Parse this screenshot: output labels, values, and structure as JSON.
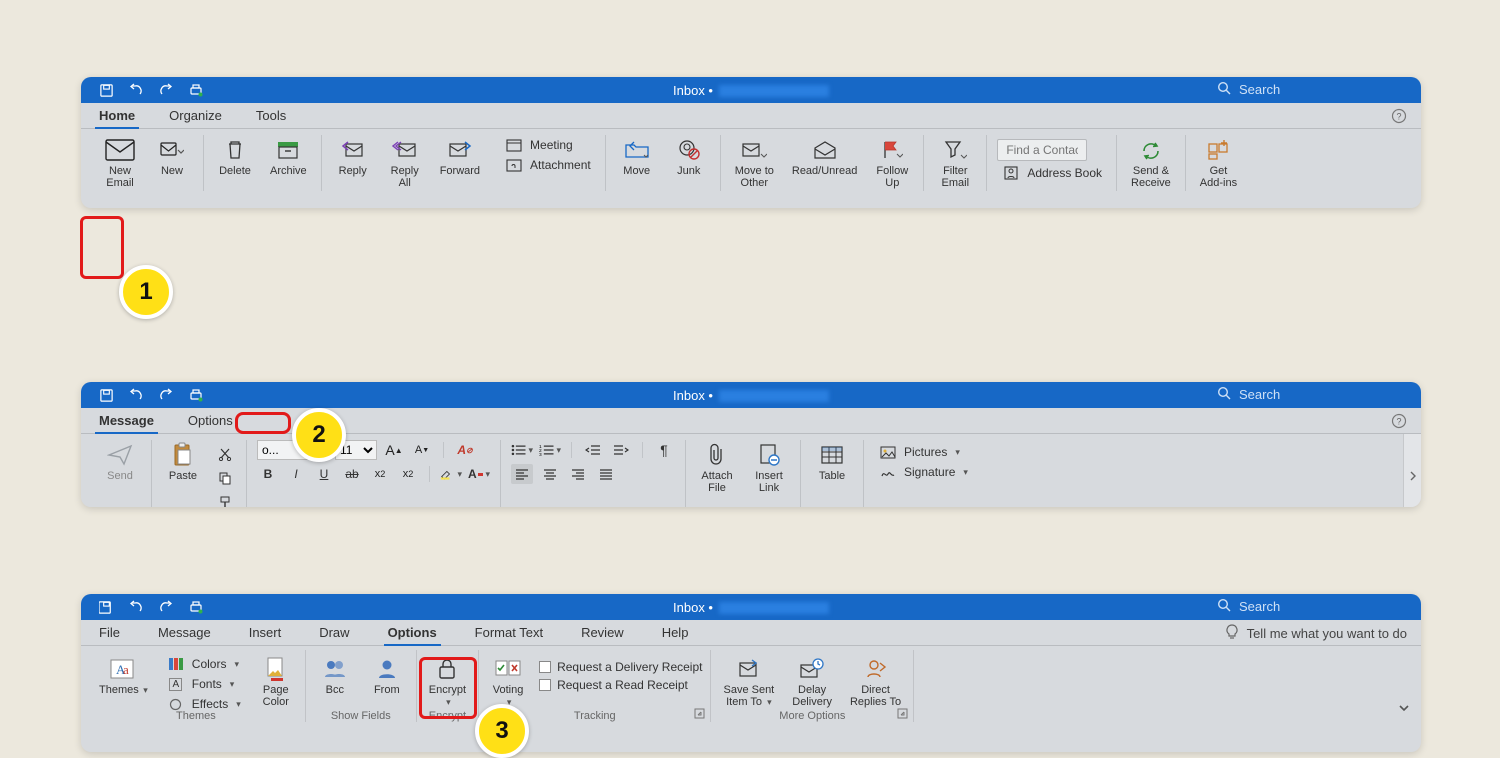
{
  "badges": {
    "s1": "1",
    "s2": "2",
    "s3": "3"
  },
  "titlebar": {
    "title_prefix": "Inbox •",
    "search_placeholder": "Search"
  },
  "win1": {
    "tabs": {
      "home": "Home",
      "organize": "Organize",
      "tools": "Tools"
    },
    "buttons": {
      "new_email": "New\nEmail",
      "new": "New",
      "delete": "Delete",
      "archive": "Archive",
      "reply": "Reply",
      "reply_all": "Reply\nAll",
      "forward": "Forward",
      "meeting": "Meeting",
      "attachment": "Attachment",
      "move": "Move",
      "junk": "Junk",
      "move_other": "Move to\nOther",
      "read_unread": "Read/Unread",
      "follow_up": "Follow\nUp",
      "filter_email": "Filter\nEmail",
      "find_contact": "Find a Contact",
      "address_book": "Address Book",
      "send_receive": "Send &\nReceive",
      "get_addins": "Get\nAdd-ins"
    }
  },
  "win2": {
    "tabs": {
      "message": "Message",
      "options": "Options"
    },
    "buttons": {
      "send": "Send",
      "paste": "Paste",
      "attach_file": "Attach\nFile",
      "insert_link": "Insert\nLink",
      "table": "Table",
      "pictures": "Pictures",
      "signature": "Signature"
    },
    "font_size": "11",
    "format_labels": {
      "increase": "A",
      "decrease": "A",
      "b": "B",
      "i": "I",
      "u": "U",
      "s": "ab",
      "sub": "x₂",
      "sup": "x²"
    }
  },
  "win3": {
    "tabs": {
      "file": "File",
      "message": "Message",
      "insert": "Insert",
      "draw": "Draw",
      "options": "Options",
      "format": "Format Text",
      "review": "Review",
      "help": "Help"
    },
    "tell_me": "Tell me what you want to do",
    "groups": {
      "themes": "Themes",
      "show_fields": "Show Fields",
      "encrypt": "Encrypt",
      "tracking": "Tracking",
      "more_options": "More Options"
    },
    "buttons": {
      "themes": "Themes",
      "colors": "Colors",
      "fonts": "Fonts",
      "effects": "Effects",
      "page_color": "Page\nColor",
      "bcc": "Bcc",
      "from": "From",
      "encrypt": "Encrypt",
      "voting": "Voting",
      "req_delivery": "Request a Delivery Receipt",
      "req_read": "Request a Read Receipt",
      "save_sent": "Save Sent\nItem To",
      "delay": "Delay\nDelivery",
      "direct": "Direct\nReplies To"
    }
  }
}
